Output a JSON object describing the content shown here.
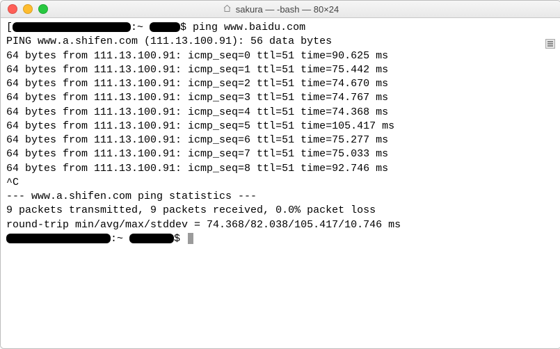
{
  "window": {
    "title": "sakura — -bash — 80×24"
  },
  "prompt1": {
    "sep1": ":~ ",
    "dollar": "$ ",
    "command": "ping www.baidu.com"
  },
  "ping_header": "PING www.a.shifen.com (111.13.100.91): 56 data bytes",
  "replies": [
    "64 bytes from 111.13.100.91: icmp_seq=0 ttl=51 time=90.625 ms",
    "64 bytes from 111.13.100.91: icmp_seq=1 ttl=51 time=75.442 ms",
    "64 bytes from 111.13.100.91: icmp_seq=2 ttl=51 time=74.670 ms",
    "64 bytes from 111.13.100.91: icmp_seq=3 ttl=51 time=74.767 ms",
    "64 bytes from 111.13.100.91: icmp_seq=4 ttl=51 time=74.368 ms",
    "64 bytes from 111.13.100.91: icmp_seq=5 ttl=51 time=105.417 ms",
    "64 bytes from 111.13.100.91: icmp_seq=6 ttl=51 time=75.277 ms",
    "64 bytes from 111.13.100.91: icmp_seq=7 ttl=51 time=75.033 ms",
    "64 bytes from 111.13.100.91: icmp_seq=8 ttl=51 time=92.746 ms"
  ],
  "interrupt": "^C",
  "stats_header": "--- www.a.shifen.com ping statistics ---",
  "stats_line1": "9 packets transmitted, 9 packets received, 0.0% packet loss",
  "stats_line2": "round-trip min/avg/max/stddev = 74.368/82.038/105.417/10.746 ms",
  "prompt2": {
    "sep1": ":~ ",
    "dollar": "$ "
  }
}
